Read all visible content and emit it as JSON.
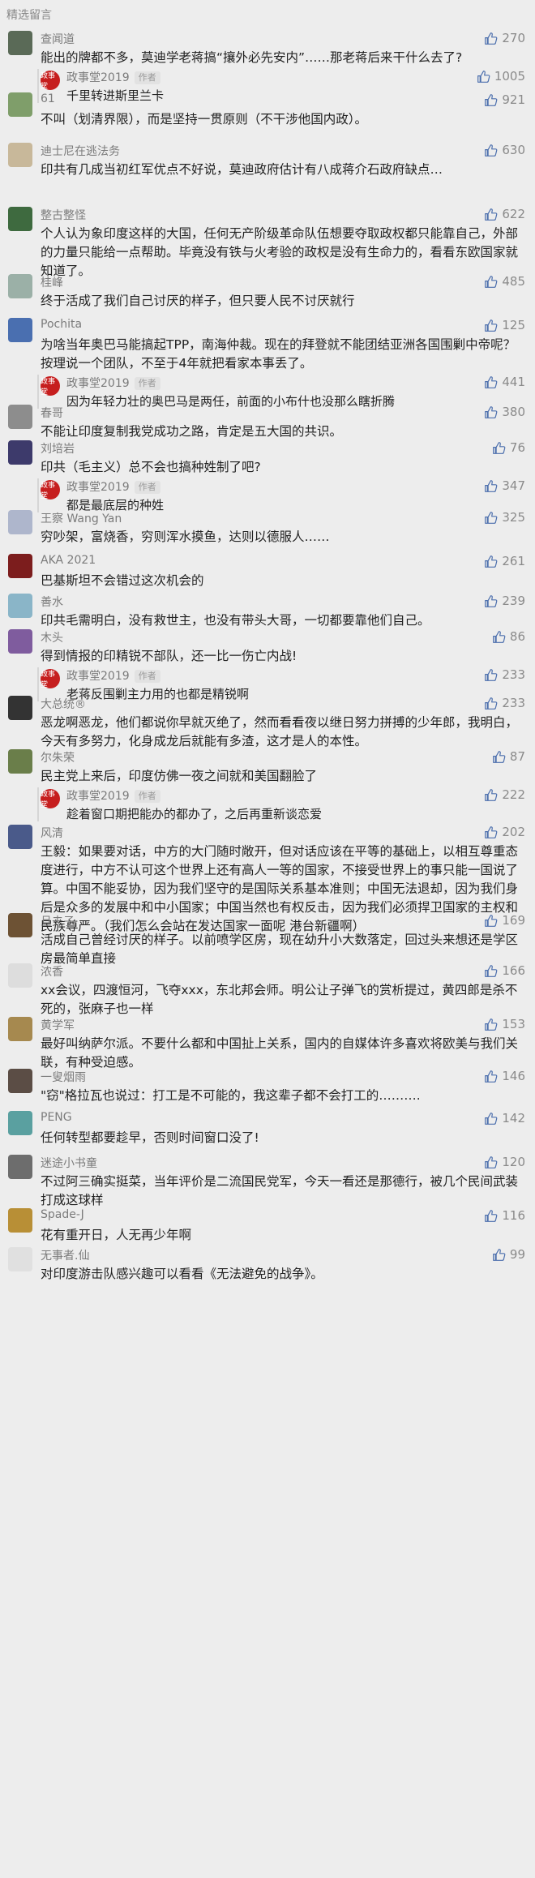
{
  "section_title": "精选留言",
  "author_badge": "作者",
  "comments": [
    {
      "nick": "查闻道",
      "likes": "270",
      "text": "能出的牌都不多，莫迪学老蒋搞“攘外必先安内”……那老蒋后来干什么去了?",
      "reply": {
        "nick": "政事堂2019",
        "likes": "1005",
        "text": "千里转进斯里兰卡"
      }
    },
    {
      "nick": "61",
      "likes": "921",
      "text": "不叫（划清界限），而是坚持一贯原则（不干涉他国内政）。"
    },
    {
      "nick": "迪士尼在逃法务",
      "likes": "630",
      "text": "印共有几成当初红军优点不好说，莫迪政府估计有八成蒋介石政府缺点…"
    },
    {
      "nick": "整古整怪",
      "likes": "622",
      "text": "个人认为象印度这样的大国，任何无产阶级革命队伍想要夺取政权都只能靠自己，外部的力量只能给一点帮助。毕竟没有铁与火考验的政权是没有生命力的，看看东欧国家就知道了。"
    },
    {
      "nick": "桂峰",
      "likes": "485",
      "text": "终于活成了我们自己讨厌的样子，但只要人民不讨厌就行"
    },
    {
      "nick": "Pochita",
      "likes": "125",
      "text": "为啥当年奥巴马能搞起TPP，南海仲裁。现在的拜登就不能团结亚洲各国围剿中帝呢？按理说一个团队，不至于4年就把看家本事丢了。",
      "reply": {
        "nick": "政事堂2019",
        "likes": "441",
        "text": "因为年轻力壮的奥巴马是两任，前面的小布什也没那么瞎折腾"
      }
    },
    {
      "nick": "春哥",
      "likes": "380",
      "text": "不能让印度复制我党成功之路，肯定是五大国的共识。"
    },
    {
      "nick": "刘培岩",
      "likes": "76",
      "text": "印共（毛主义）总不会也搞种姓制了吧?",
      "reply": {
        "nick": "政事堂2019",
        "likes": "347",
        "text": "都是最底层的种姓"
      }
    },
    {
      "nick": "王察 Wang Yan",
      "likes": "325",
      "text": "穷吵架，富烧香，穷则浑水摸鱼，达则以德服人……"
    },
    {
      "nick": "AKA 2021",
      "likes": "261",
      "text": "巴基斯坦不会错过这次机会的"
    },
    {
      "nick": "善水",
      "likes": "239",
      "text": "印共毛需明白，没有救世主，也没有带头大哥，一切都要靠他们自己。"
    },
    {
      "nick": "木头",
      "likes": "86",
      "text": "得到情报的印精锐不部队，还一比一伤亡内战!",
      "reply": {
        "nick": "政事堂2019",
        "likes": "233",
        "text": "老蒋反围剿主力用的也都是精锐啊"
      }
    },
    {
      "nick": "大总统®",
      "likes": "233",
      "text": "恶龙啊恶龙，他们都说你早就灭绝了，然而看看夜以继日努力拼搏的少年郎，我明白，今天有多努力，化身成龙后就能有多渣，这才是人的本性。"
    },
    {
      "nick": "尔朱荣",
      "likes": "87",
      "text": "民主党上来后，印度仿佛一夜之间就和美国翻脸了",
      "reply": {
        "nick": "政事堂2019",
        "likes": "222",
        "text": "趁着窗口期把能办的都办了，之后再重新谈恋爱"
      }
    },
    {
      "nick": "风清",
      "likes": "202",
      "text": "王毅：如果要对话，中方的大门随时敞开，但对话应该在平等的基础上，以相互尊重态度进行，中方不认可这个世界上还有高人一等的国家，不接受世界上的事只能一国说了算。中国不能妥协，因为我们坚守的是国际关系基本准则；中国无法退却，因为我们身后是众多的发展中和中小国家；中国当然也有权反击，因为我们必须捍卫国家的主权和民族尊严。（我们怎么会站在发达国家一面呢  港台新疆啊）"
    },
    {
      "nick": "旦夫子",
      "likes": "169",
      "text": "活成自己曾经讨厌的样子。以前喷学区房，现在幼升小大数落定，回过头来想还是学区房最简单直接"
    },
    {
      "nick": "浓香",
      "likes": "166",
      "text": "xx会议，四渡恒河，飞夺xxx，东北邦会师。明公让子弹飞的赏析提过，黄四郎是杀不死的，张麻子也一样"
    },
    {
      "nick": "黄学军",
      "likes": "153",
      "text": "最好叫纳萨尔派。不要什么都和中国扯上关系，国内的自媒体许多喜欢将欧美与我们关联，有种受迫感。"
    },
    {
      "nick": "一叟烟雨",
      "likes": "146",
      "text": "\"窃\"格拉瓦也说过：打工是不可能的，我这辈子都不会打工的………."
    },
    {
      "nick": "PENG",
      "likes": "142",
      "text": "任何转型都要趁早，否则时间窗口没了!"
    },
    {
      "nick": "迷途小书童",
      "likes": "120",
      "text": "不过阿三确实挺菜，当年评价是二流国民党军，今天一看还是那德行，被几个民间武装打成这球样"
    },
    {
      "nick": "Spade-J",
      "likes": "116",
      "text": "花有重开日，人无再少年啊"
    },
    {
      "nick": "无事者.仙",
      "likes": "99",
      "text": "对印度游击队感兴趣可以看看《无法避免的战争》。"
    }
  ]
}
